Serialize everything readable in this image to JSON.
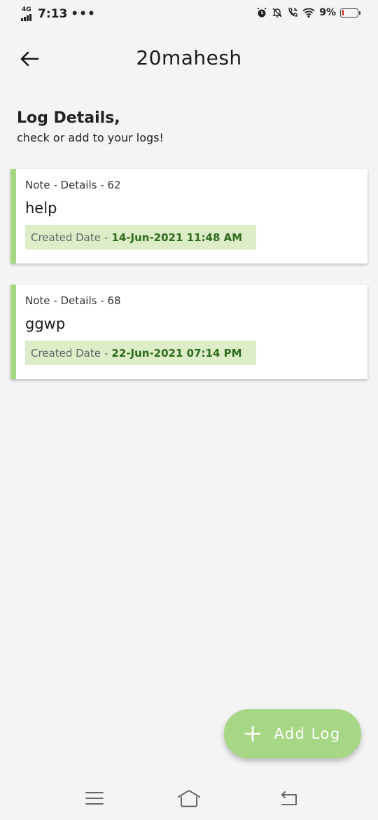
{
  "status_bar": {
    "network": "4G",
    "time": "7:13",
    "dots": "•••",
    "battery_percent": "9%",
    "battery_level": 0.09,
    "icons": [
      "alarm-icon",
      "bell-off-icon",
      "wifi-call-icon",
      "wifi-icon",
      "battery-icon"
    ]
  },
  "header": {
    "title": "20mahesh",
    "back_icon": "arrow-left-icon"
  },
  "intro": {
    "heading": "Log Details,",
    "subheading": "check or add to your logs!"
  },
  "logs": [
    {
      "meta": "Note - Details - 62",
      "title": "help",
      "date_label": "Created Date",
      "date_separator": "-",
      "date_value": "14-Jun-2021 11:48 AM"
    },
    {
      "meta": "Note - Details - 68",
      "title": "ggwp",
      "date_label": "Created Date",
      "date_separator": "-",
      "date_value": "22-Jun-2021 07:14 PM"
    }
  ],
  "fab": {
    "icon": "plus-icon",
    "label": "Add Log"
  },
  "colors": {
    "accent": "#a6d785",
    "badge_bg": "#dcedc8",
    "date_text": "#2e6b1f",
    "background": "#f4f4f4"
  },
  "nav_bar": {
    "icons": [
      "menu-icon",
      "home-icon",
      "back-icon"
    ]
  }
}
